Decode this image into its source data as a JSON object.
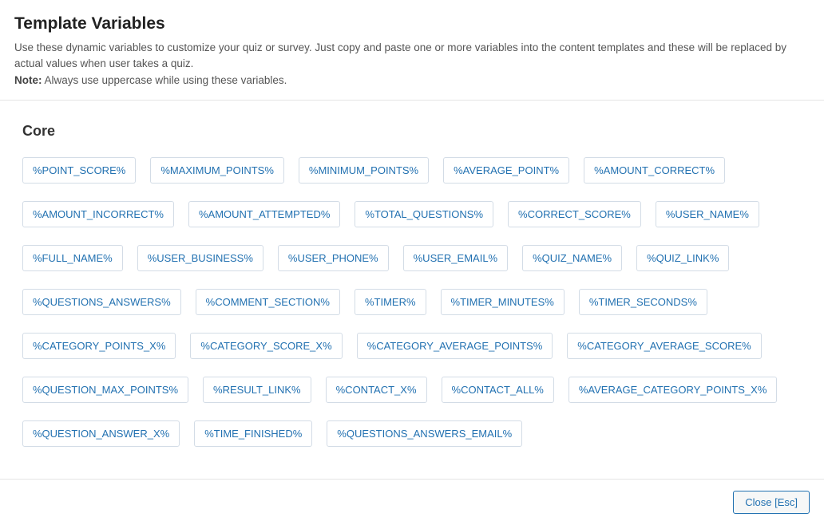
{
  "header": {
    "title": "Template Variables",
    "description_part1": "Use these dynamic variables to customize your quiz or survey. Just copy and paste one or more variables into the content templates and these will be replaced by actual values when user takes a quiz.",
    "note_prefix": "Note:",
    "note_text": " Always use uppercase while using these variables."
  },
  "section": {
    "heading": "Core",
    "variables": [
      "%POINT_SCORE%",
      "%MAXIMUM_POINTS%",
      "%MINIMUM_POINTS%",
      "%AVERAGE_POINT%",
      "%AMOUNT_CORRECT%",
      "%AMOUNT_INCORRECT%",
      "%AMOUNT_ATTEMPTED%",
      "%TOTAL_QUESTIONS%",
      "%CORRECT_SCORE%",
      "%USER_NAME%",
      "%FULL_NAME%",
      "%USER_BUSINESS%",
      "%USER_PHONE%",
      "%USER_EMAIL%",
      "%QUIZ_NAME%",
      "%QUIZ_LINK%",
      "%QUESTIONS_ANSWERS%",
      "%COMMENT_SECTION%",
      "%TIMER%",
      "%TIMER_MINUTES%",
      "%TIMER_SECONDS%",
      "%CATEGORY_POINTS_X%",
      "%CATEGORY_SCORE_X%",
      "%CATEGORY_AVERAGE_POINTS%",
      "%CATEGORY_AVERAGE_SCORE%",
      "%QUESTION_MAX_POINTS%",
      "%RESULT_LINK%",
      "%CONTACT_X%",
      "%CONTACT_ALL%",
      "%AVERAGE_CATEGORY_POINTS_X%",
      "%QUESTION_ANSWER_X%",
      "%TIME_FINISHED%",
      "%QUESTIONS_ANSWERS_EMAIL%"
    ]
  },
  "footer": {
    "close_label": "Close [Esc]"
  }
}
